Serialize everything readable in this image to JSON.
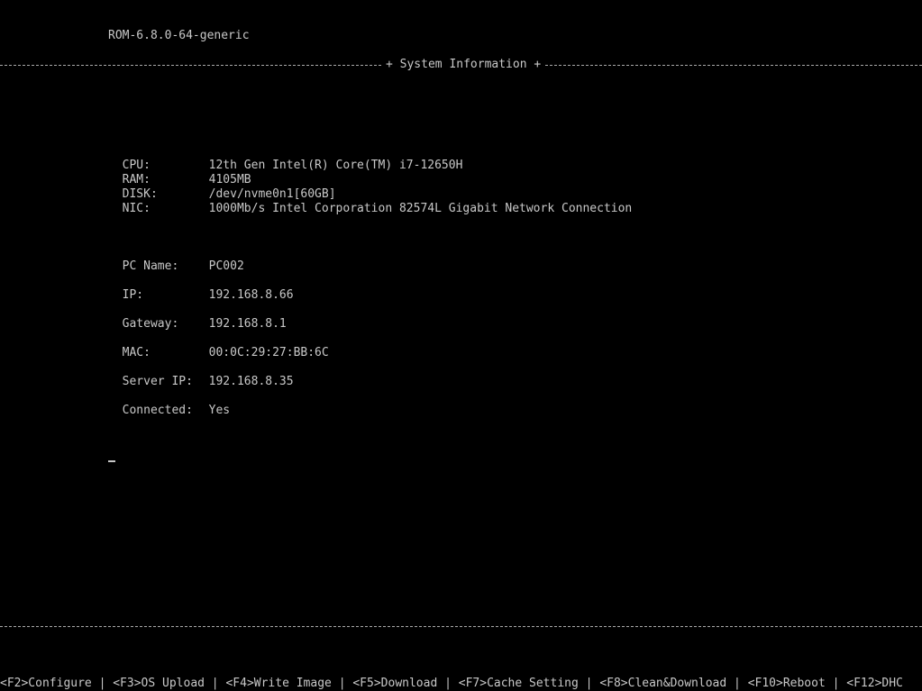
{
  "header": {
    "rom_version": "ROM-6.8.0-64-generic",
    "section_title": "+ System Information +"
  },
  "hardware": [
    {
      "label": "CPU:",
      "value": "12th Gen Intel(R) Core(TM) i7-12650H"
    },
    {
      "label": "RAM:",
      "value": "4105MB"
    },
    {
      "label": "DISK:",
      "value": "/dev/nvme0n1[60GB]"
    },
    {
      "label": "NIC:",
      "value": "1000Mb/s Intel Corporation 82574L Gigabit Network Connection"
    }
  ],
  "network": [
    {
      "label": "PC Name:",
      "value": "PC002"
    },
    {
      "label": "IP:",
      "value": "192.168.8.66"
    },
    {
      "label": "Gateway:",
      "value": "192.168.8.1"
    },
    {
      "label": "MAC:",
      "value": "00:0C:29:27:BB:6C"
    },
    {
      "label": "Server IP:",
      "value": "192.168.8.35"
    },
    {
      "label": "Connected:",
      "value": "Yes"
    }
  ],
  "menu": {
    "separator": " | ",
    "items": [
      "<F2>Configure",
      "<F3>OS Upload",
      "<F4>Write Image",
      "<F5>Download",
      "<F7>Cache Setting",
      "<F8>Clean&Download",
      "<F10>Reboot",
      "<F12>DHC"
    ]
  }
}
